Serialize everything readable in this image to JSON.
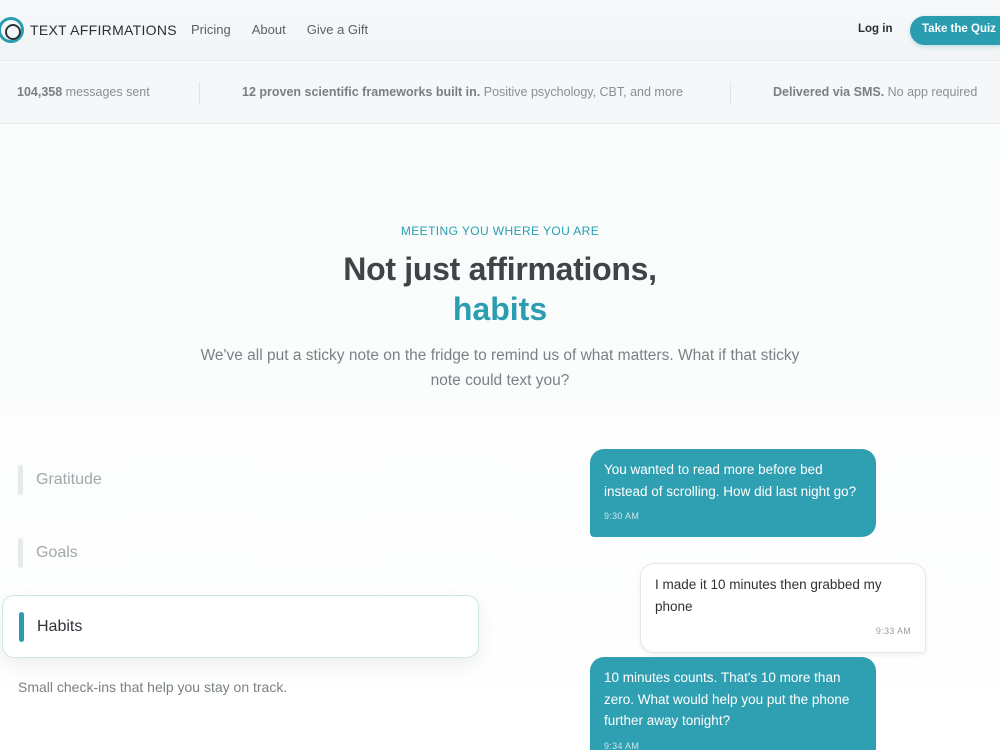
{
  "header": {
    "brand": "TEXT AFFIRMATIONS",
    "nav": [
      "Pricing",
      "About",
      "Give a Gift"
    ],
    "login_label": "Log in",
    "cta_label": "Take the Quiz"
  },
  "stats": [
    {
      "strong": "104,358",
      "text": " messages sent"
    },
    {
      "strong": "12 proven scientific frameworks built in.",
      "text": " Positive psychology, CBT, and more"
    },
    {
      "strong": "Delivered via SMS.",
      "text": " No app required"
    }
  ],
  "hero": {
    "eyebrow": "MEETING YOU WHERE YOU ARE",
    "title": "Not just affirmations,",
    "title_accent": "habits",
    "lede": "We've all put a sticky note on the fridge to remind us of what matters. What if that sticky note could text you?"
  },
  "topics": {
    "items": [
      "Gratitude",
      "Goals",
      "Habits"
    ],
    "active": "Habits",
    "active_description": "Small check-ins that help you stay on track."
  },
  "chat": [
    {
      "from": "service",
      "text": "You wanted to read more before bed instead of scrolling. How did last night go?",
      "time": "9:30 AM"
    },
    {
      "from": "user",
      "text": "I made it 10 minutes then grabbed my phone",
      "time": "9:33 AM"
    },
    {
      "from": "service",
      "text": "10 minutes counts. That's 10 more than zero. What would help you put the phone further away tonight?",
      "time": "9:34 AM"
    }
  ],
  "colors": {
    "accent": "#2a9db0",
    "heading": "#404348",
    "muted": "#7b8086"
  }
}
